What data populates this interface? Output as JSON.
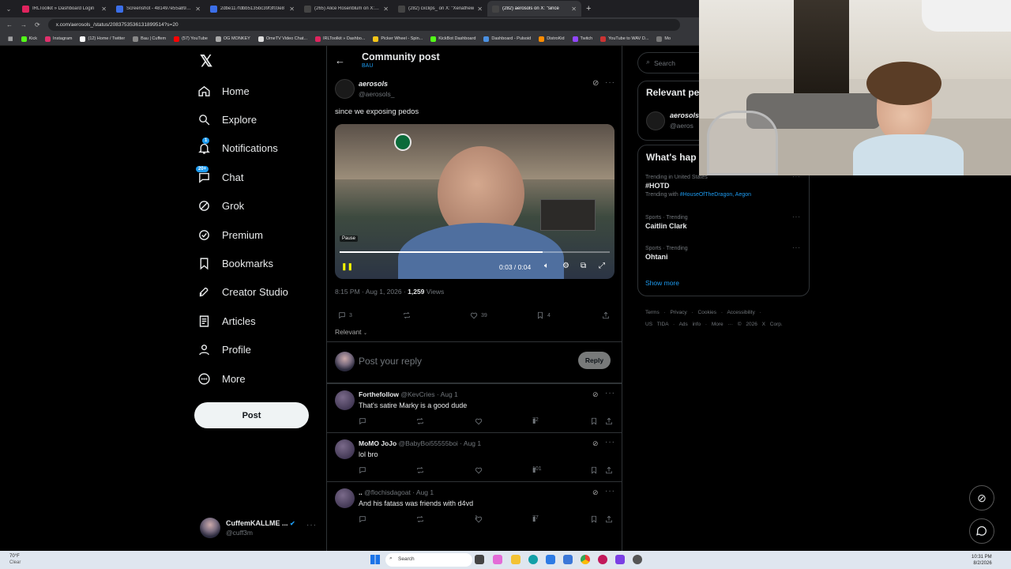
{
  "browser": {
    "tabs": [
      {
        "title": "IRLToolkit » Dashboard Login",
        "color": "#e0245e"
      },
      {
        "title": "Screenshot - 481497e55a897f0",
        "color": "#3b6ee8"
      },
      {
        "title": "2dbe117fdbb5135bc39f3f03e8",
        "color": "#3b6ee8"
      },
      {
        "title": "(265) Alice Rosenblum on X: \"D",
        "color": "#444"
      },
      {
        "title": "(282) cxclips_ on X: \"Xenathew",
        "color": "#444"
      },
      {
        "title": "(282) aerosols on X: \"since",
        "color": "#444"
      }
    ],
    "url": "x.com/aerosols_/status/2083753536131899514?s=20",
    "bookmarks": [
      {
        "label": "Kick",
        "color": "#53fc18"
      },
      {
        "label": "Instagram",
        "color": "#e1306c"
      },
      {
        "label": "(12) Home / Twitter",
        "color": "#fff"
      },
      {
        "label": "Bau | Cuffem",
        "color": "#888"
      },
      {
        "label": "(57) YouTube",
        "color": "#f00"
      },
      {
        "label": "OG MONKEY",
        "color": "#aaa"
      },
      {
        "label": "OmeTV Video Chat...",
        "color": "#ddd"
      },
      {
        "label": "IRLToolkit » Dashbo...",
        "color": "#e0245e"
      },
      {
        "label": "Picker Wheel - Spin...",
        "color": "#f5c518"
      },
      {
        "label": "KickBot Dashboard",
        "color": "#53fc18"
      },
      {
        "label": "Dashboard - Pulsoid",
        "color": "#4a90e2"
      },
      {
        "label": "DistroKid",
        "color": "#ff8c00"
      },
      {
        "label": "Twitch",
        "color": "#9146ff"
      },
      {
        "label": "YouTube to WAV D...",
        "color": "#c33"
      },
      {
        "label": "Mo",
        "color": "#777"
      }
    ]
  },
  "nav": {
    "items": [
      {
        "label": "Home",
        "icon": "home-icon"
      },
      {
        "label": "Explore",
        "icon": "search-icon"
      },
      {
        "label": "Notifications",
        "icon": "bell-icon",
        "badge": "1"
      },
      {
        "label": "Chat",
        "icon": "chat-icon",
        "badge": "20+"
      },
      {
        "label": "Grok",
        "icon": "grok-icon"
      },
      {
        "label": "Premium",
        "icon": "premium-icon"
      },
      {
        "label": "Bookmarks",
        "icon": "bookmark-icon"
      },
      {
        "label": "Creator Studio",
        "icon": "rocket-icon"
      },
      {
        "label": "Articles",
        "icon": "article-icon"
      },
      {
        "label": "Profile",
        "icon": "person-icon"
      },
      {
        "label": "More",
        "icon": "more-icon"
      }
    ],
    "post_button": "Post",
    "account": {
      "name": "CuffemKALLME ...",
      "handle": "@cuff3m"
    }
  },
  "main": {
    "header_title": "Community post",
    "header_sub": "BAU",
    "post": {
      "author_name": "aerosols",
      "author_handle": "@aerosols_",
      "text": "since we exposing pedos",
      "video": {
        "pause_tooltip": "Pause",
        "time": "0:03 / 0:04",
        "progress": 0.75
      },
      "timestamp": "8:15 PM · Aug 1, 2026 · ",
      "views_count": "1,259",
      "views_label": " Views",
      "stats": {
        "replies": "3",
        "reposts": "",
        "likes": "39",
        "bookmarks": "4"
      }
    },
    "sort_label": "Relevant",
    "reply_placeholder": "Post your reply",
    "reply_button": "Reply",
    "replies": [
      {
        "name": "Forthefollow",
        "handle": "@KevCries · Aug 1",
        "text": "That's satire Marky is a good dude",
        "likes": "",
        "views": "72"
      },
      {
        "name": "MoMO JoJo",
        "handle": "@BabyBoi55555boi · Aug 1",
        "text": "lol bro",
        "likes": "",
        "views": "101"
      },
      {
        "name": "..",
        "handle": "@flochisdagoat · Aug 1",
        "text": "And his fatass was friends with d4vd",
        "likes": "1",
        "views": "77"
      }
    ]
  },
  "right": {
    "search_placeholder": "Search",
    "relevant_title": "Relevant pe",
    "relevant_user": {
      "name": "aerosols",
      "handle": "@aeros"
    },
    "whats_happening": "What's hap",
    "trends": [
      {
        "context": "Trending in United States",
        "title": "#HOTD",
        "extra_prefix": "Trending with ",
        "extra_link": "#HouseOfTheDragon",
        "extra_suffix": ", Aegon"
      },
      {
        "context": "Sports · Trending",
        "title": "Caitlin Clark"
      },
      {
        "context": "Sports · Trending",
        "title": "Ohtani"
      }
    ],
    "show_more": "Show more",
    "footer_line1": "Terms · Privacy · Cookies · Accessibility ·",
    "footer_line2": "US TIDA · Ads info · More ··· © 2026 X Corp."
  },
  "taskbar": {
    "weather_temp": "70°F",
    "weather_desc": "Clear",
    "search_label": "Search",
    "time": "10:31 PM",
    "date": "8/2/2026"
  }
}
